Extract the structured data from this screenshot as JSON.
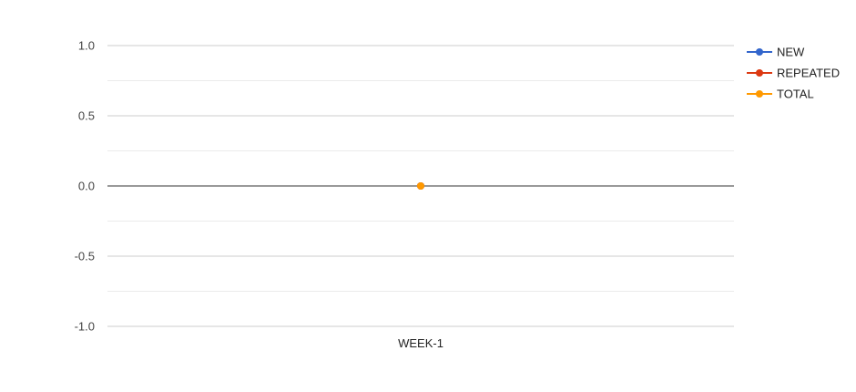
{
  "chart_data": {
    "type": "line",
    "title": "",
    "xlabel": "",
    "ylabel": "",
    "categories": [
      "WEEK-1"
    ],
    "ylim": [
      -1.0,
      1.0
    ],
    "yticks": [
      "1.0",
      "0.5",
      "0.0",
      "-0.5",
      "-1.0"
    ],
    "grid": true,
    "legend_position": "right",
    "series": [
      {
        "name": "NEW",
        "values": [
          0
        ],
        "color": "#3366cc"
      },
      {
        "name": "REPEATED",
        "values": [
          0
        ],
        "color": "#dc3912"
      },
      {
        "name": "TOTAL",
        "values": [
          0
        ],
        "color": "#ff9900"
      }
    ]
  }
}
